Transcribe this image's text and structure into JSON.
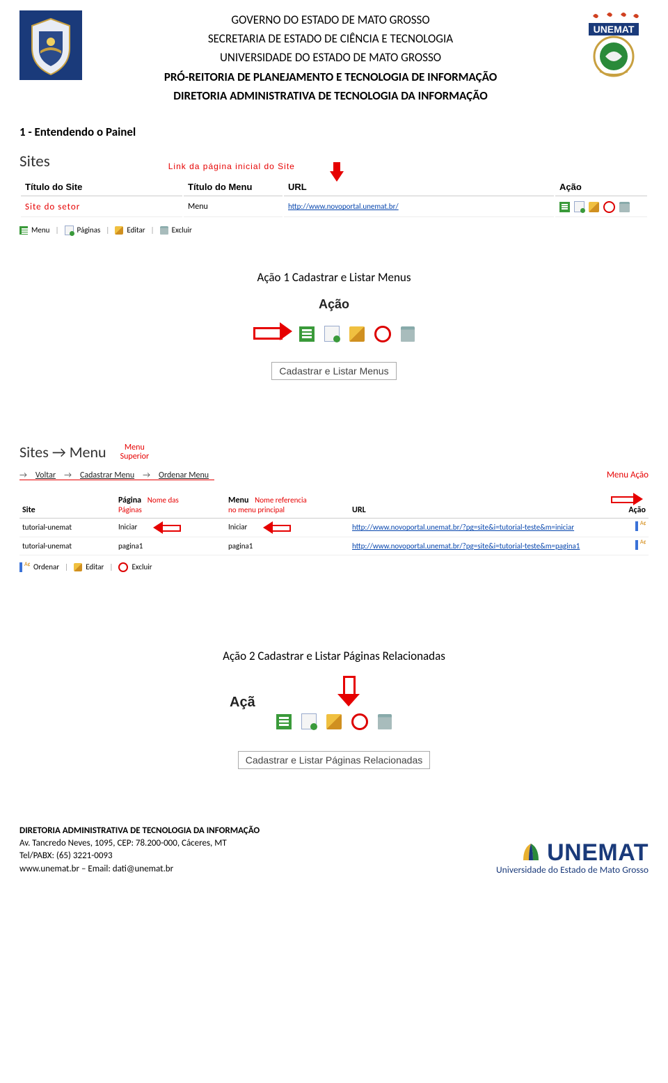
{
  "header": {
    "line1": "GOVERNO DO ESTADO DE MATO GROSSO",
    "line2": "SECRETARIA DE ESTADO DE CIÊNCIA E TECNOLOGIA",
    "line3": "UNIVERSIDADE DO ESTADO DE MATO GROSSO",
    "line4": "PRÓ-REITORIA DE PLANEJAMENTO E TECNOLOGIA DE INFORMAÇÃO",
    "line5": "DIRETORIA ADMINISTRATIVA DE TECNOLOGIA DA INFORMAÇÃO"
  },
  "section1_title": "1 - Entendendo o Painel",
  "shot1": {
    "sites_label": "Sites",
    "link_ann": "Link da página inicial do Site",
    "cols": {
      "c1": "Título do Site",
      "c2": "Título do Menu",
      "c3": "URL",
      "c4": "Ação"
    },
    "row": {
      "site": "Site  do  setor",
      "menu": "Menu",
      "url": "http://www.novoportal.unemat.br/"
    },
    "legend": {
      "menu": "Menu",
      "paginas": "Páginas",
      "editar": "Editar",
      "excluir": "Excluir"
    }
  },
  "caption1": "Ação 1 Cadastrar e Listar Menus",
  "shot2": {
    "acao": "Ação",
    "tooltip": "Cadastrar e Listar Menus"
  },
  "shot3": {
    "sites_menu": "Sites → Menu",
    "menu_superior": "Menu\nSuperior",
    "voltar": "Voltar",
    "cadastrar_menu": "Cadastrar Menu",
    "ordenar_menu": "Ordenar Menu",
    "menu_acao": "Menu Ação",
    "cols": {
      "site": "Site",
      "pagina": "Página",
      "menu": "Menu",
      "url": "URL",
      "acao": "Ação"
    },
    "ann_paginas": "Nome das\nPáginas",
    "ann_menu": "Nome referencia\nno menu principal",
    "rows": [
      {
        "site": "tutorial-unemat",
        "pagina": "Iniciar",
        "menu": "Iniciar",
        "url": "http://www.novoportal.unemat.br/?pg=site&i=tutorial-teste&m=iniciar"
      },
      {
        "site": "tutorial-unemat",
        "pagina": "pagina1",
        "menu": "pagina1",
        "url": "http://www.novoportal.unemat.br/?pg=site&i=tutorial-teste&m=pagina1"
      }
    ],
    "legend": {
      "ordenar": "Ordenar",
      "editar": "Editar",
      "excluir": "Excluir"
    }
  },
  "caption2": "Ação 2 Cadastrar e Listar Páginas Relacionadas",
  "shot4": {
    "acao_partial": "Açã",
    "tooltip": "Cadastrar e Listar Páginas Relacionadas"
  },
  "footer": {
    "l1": "DIRETORIA ADMINISTRATIVA DE TECNOLOGIA DA INFORMAÇÃO",
    "l2": "Av. Tancredo Neves, 1095, CEP: 78.200-000, Cáceres, MT",
    "l3": "Tel/PABX: (65) 3221-0093",
    "l4": "www.unemat.br – Email: dati@unemat.br",
    "brand": "UNEMAT",
    "brand_sub": "Universidade do Estado de Mato Grosso"
  }
}
